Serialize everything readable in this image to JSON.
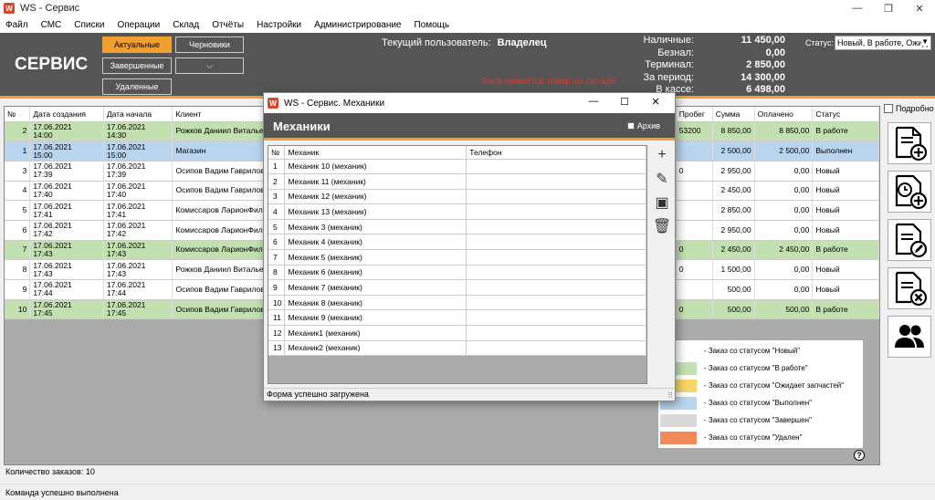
{
  "window": {
    "title": "WS - Сервис",
    "icon_text": "W"
  },
  "window_controls": {
    "minimize": "—",
    "maximize": "❐",
    "close": "✕"
  },
  "menu": [
    "Файл",
    "СМС",
    "Списки",
    "Операции",
    "Склад",
    "Отчёты",
    "Настройки",
    "Администрирование",
    "Помощь"
  ],
  "header": {
    "brand": "СЕРВИС",
    "filters": {
      "actual": "Актуальные",
      "drafts": "Черновики",
      "completed": "Завершенные",
      "more": "⌵",
      "deleted": "Удаленные"
    },
    "current_user_label": "Текущий пользователь:",
    "current_user": "Владелец",
    "warning": "Заканчивается товар на складе",
    "cash": [
      {
        "label": "Наличные:",
        "value": "11 450,00"
      },
      {
        "label": "Безнал:",
        "value": "0,00"
      },
      {
        "label": "Терминал:",
        "value": "2 850,00"
      },
      {
        "label": "За период:",
        "value": "14 300,00"
      },
      {
        "label": "В кассе:",
        "value": "6 498,00"
      }
    ],
    "status_label": "Статус:",
    "status_value": "Новый, В работе, Ожид"
  },
  "orders": {
    "columns": [
      "№",
      "Дата создания",
      "Дата начала",
      "Клиент",
      "",
      "Пробег",
      "Сумма",
      "Оплачено",
      "Статус"
    ],
    "rows": [
      {
        "n": "2",
        "created": "17.06.2021\n14:00",
        "start": "17.06.2021\n14:30",
        "client": "Рожков Даниил Виталье",
        "mileage": "53200",
        "sum": "8 850,00",
        "paid": "8 850,00",
        "status": "В работе",
        "color": "green"
      },
      {
        "n": "1",
        "created": "17.06.2021\n15:00",
        "start": "17.06.2021\n15:00",
        "client": "Магазин",
        "mileage": "",
        "sum": "2 500,00",
        "paid": "2 500,00",
        "status": "Выполнен",
        "color": "blue"
      },
      {
        "n": "3",
        "created": "17.06.2021\n17:39",
        "start": "17.06.2021\n17:39",
        "client": "Осипов Вадим Гаврилов",
        "mileage": "0",
        "sum": "2 950,00",
        "paid": "0,00",
        "status": "Новый",
        "color": "white"
      },
      {
        "n": "4",
        "created": "17.06.2021\n17:40",
        "start": "17.06.2021\n17:40",
        "client": "Осипов Вадим Гаврилов",
        "mileage": "",
        "sum": "2 450,00",
        "paid": "0,00",
        "status": "Новый",
        "color": "white"
      },
      {
        "n": "5",
        "created": "17.06.2021\n17:41",
        "start": "17.06.2021\n17:41",
        "client": "Комиссаров ЛарионФил",
        "mileage": "",
        "sum": "2 850,00",
        "paid": "0,00",
        "status": "Новый",
        "color": "white"
      },
      {
        "n": "6",
        "created": "17.06.2021\n17:42",
        "start": "17.06.2021\n17:42",
        "client": "Комиссаров ЛарионФил",
        "mileage": "",
        "sum": "2 950,00",
        "paid": "0,00",
        "status": "Новый",
        "color": "white"
      },
      {
        "n": "7",
        "created": "17.06.2021\n17:43",
        "start": "17.06.2021\n17:43",
        "client": "Комиссаров ЛарионФил",
        "mileage": "0",
        "sum": "2 450,00",
        "paid": "2 450,00",
        "status": "В работе",
        "color": "green"
      },
      {
        "n": "8",
        "created": "17.06.2021\n17:43",
        "start": "17.06.2021\n17:43",
        "client": "Рожков Даниил Виталье",
        "mileage": "0",
        "sum": "1 500,00",
        "paid": "0,00",
        "status": "Новый",
        "color": "white"
      },
      {
        "n": "9",
        "created": "17.06.2021\n17:44",
        "start": "17.06.2021\n17:44",
        "client": "Осипов Вадим Гаврилов",
        "mileage": "",
        "sum": "500,00",
        "paid": "0,00",
        "status": "Новый",
        "color": "white"
      },
      {
        "n": "10",
        "created": "17.06.2021\n17:45",
        "start": "17.06.2021\n17:45",
        "client": "Осипов Вадим Гаврилов",
        "mileage": "0",
        "sum": "500,00",
        "paid": "500,00",
        "status": "В работе",
        "color": "green"
      }
    ]
  },
  "count_label": "Количество заказов: 10",
  "status_bar": "Команда успешно выполнена",
  "right_panel": {
    "detail_label": "Подробно"
  },
  "legend": [
    {
      "label": "- Заказ со статусом \"Новый\"",
      "color": "#ffffff"
    },
    {
      "label": "- Заказ со статусом \"В работе\"",
      "color": "#c2e0b0"
    },
    {
      "label": "- Заказ со статусом \"Ожидает запчастей\"",
      "color": "#f5d66a"
    },
    {
      "label": "- Заказ со статусом \"Выполнен\"",
      "color": "#b9d5ee"
    },
    {
      "label": "- Заказ со статусом \"Завершен\"",
      "color": "#d8d8d8"
    },
    {
      "label": "- Заказ со статусом \"Удален\"",
      "color": "#f08a5a"
    }
  ],
  "help": "?",
  "modal": {
    "title": "WS - Сервис. Механики",
    "header": "Механики",
    "archive_label": "Архив",
    "columns": [
      "№",
      "Механик",
      "Телефон"
    ],
    "rows": [
      {
        "n": "1",
        "name": "Механик 10 (механик)",
        "phone": ""
      },
      {
        "n": "2",
        "name": "Механик 11 (механик)",
        "phone": ""
      },
      {
        "n": "3",
        "name": "Механик 12 (механик)",
        "phone": ""
      },
      {
        "n": "4",
        "name": "Механик 13 (механик)",
        "phone": ""
      },
      {
        "n": "5",
        "name": "Механик 3 (механик)",
        "phone": ""
      },
      {
        "n": "6",
        "name": "Механик 4  (механик)",
        "phone": ""
      },
      {
        "n": "7",
        "name": "Механик 5 (механик)",
        "phone": ""
      },
      {
        "n": "8",
        "name": "Механик 6 (механик)",
        "phone": ""
      },
      {
        "n": "9",
        "name": "Механик 7 (механик)",
        "phone": ""
      },
      {
        "n": "10",
        "name": "Механик 8 (механик)",
        "phone": ""
      },
      {
        "n": "11",
        "name": "Механик 9 (механик)",
        "phone": ""
      },
      {
        "n": "12",
        "name": "Механик1 (механик)",
        "phone": ""
      },
      {
        "n": "13",
        "name": "Механик2 (механик)",
        "phone": ""
      }
    ],
    "tools": {
      "add": "+",
      "edit": "✎",
      "archive": "▣",
      "delete": "🗑"
    },
    "status": "Форма успешно загружена",
    "grip": "⠿",
    "controls": {
      "minimize": "—",
      "maximize": "☐",
      "close": "✕"
    }
  },
  "colors": {
    "accent": "#f0a030",
    "header_bg": "#555555",
    "warning": "#e8352a",
    "in_work": "#c2e0b0",
    "done": "#b9d5ee"
  }
}
